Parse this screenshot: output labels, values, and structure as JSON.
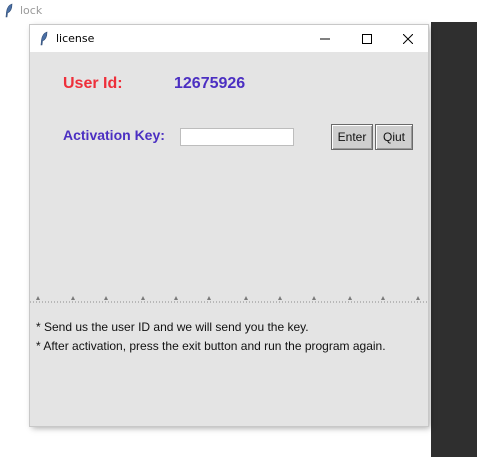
{
  "background_window": {
    "title": "lock"
  },
  "window": {
    "title": "license",
    "controls": {
      "minimize": "minimize-icon",
      "maximize": "maximize-icon",
      "close": "close-icon"
    }
  },
  "form": {
    "user_id_label": "User Id:",
    "user_id_value": "12675926",
    "activation_key_label": "Activation Key:",
    "activation_key_value": "",
    "activation_key_placeholder": "",
    "enter_button": "Enter",
    "quit_button": "Qiut"
  },
  "notes": {
    "line1": "* Send us the user ID and we will send you the key.",
    "line2": "* After activation, press the exit button and run the program again."
  },
  "colors": {
    "user_id_label": "#ee2f3a",
    "accent_purple": "#4b2fc2",
    "window_bg": "#e4e4e4"
  }
}
